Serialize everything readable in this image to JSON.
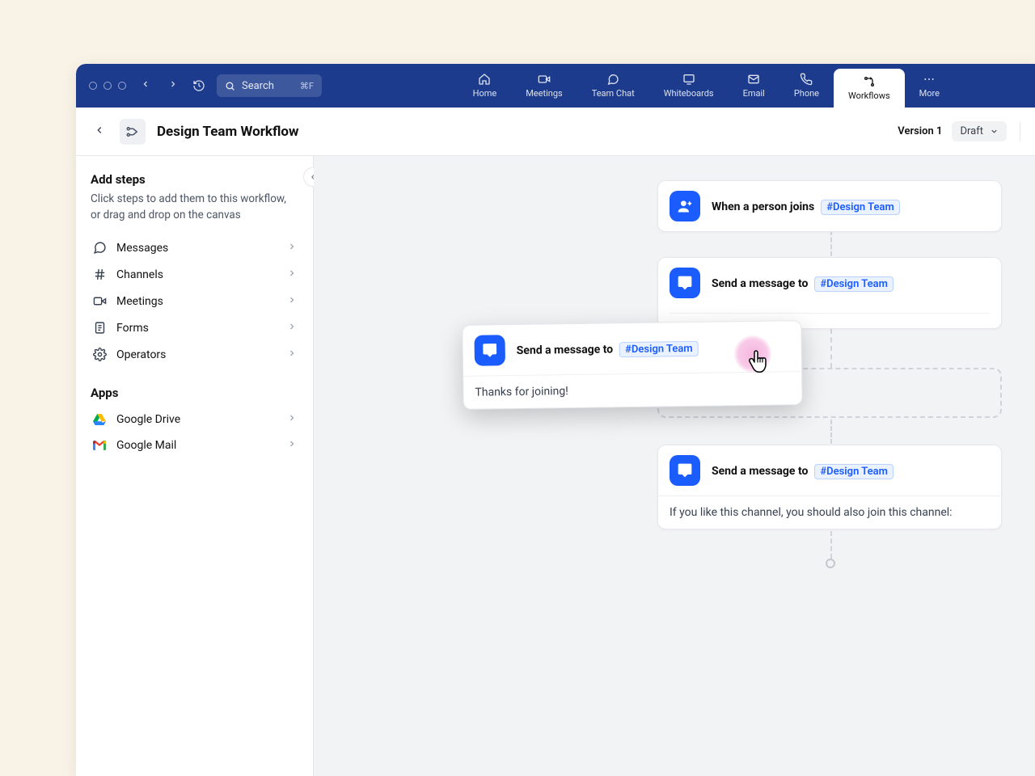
{
  "topbar": {
    "search_placeholder": "Search",
    "search_shortcut": "⌘F",
    "nav": [
      {
        "label": "Home"
      },
      {
        "label": "Meetings"
      },
      {
        "label": "Team Chat"
      },
      {
        "label": "Whiteboards"
      },
      {
        "label": "Email"
      },
      {
        "label": "Phone"
      },
      {
        "label": "Workflows"
      },
      {
        "label": "More"
      }
    ]
  },
  "subheader": {
    "title": "Design Team Workflow",
    "version": "Version 1",
    "status": "Draft"
  },
  "sidebar": {
    "heading": "Add steps",
    "description": "Click steps to add them to this workflow, or drag and drop on the canvas",
    "steps": [
      {
        "label": "Messages"
      },
      {
        "label": "Channels"
      },
      {
        "label": "Meetings"
      },
      {
        "label": "Forms"
      },
      {
        "label": "Operators"
      }
    ],
    "apps_heading": "Apps",
    "apps": [
      {
        "label": "Google Drive"
      },
      {
        "label": "Google Mail"
      }
    ]
  },
  "canvas": {
    "node1": {
      "title": "When a person joins",
      "channel": "#Design Team"
    },
    "node2": {
      "title": "Send a message to",
      "channel": "#Design Team"
    },
    "node3": {
      "title": "Send a message to",
      "channel": "#Design Team",
      "body": "If you like this channel, you should also join this channel:"
    },
    "dragged": {
      "title": "Send a message to",
      "channel": "#Design Team",
      "body": "Thanks for joining!"
    }
  }
}
